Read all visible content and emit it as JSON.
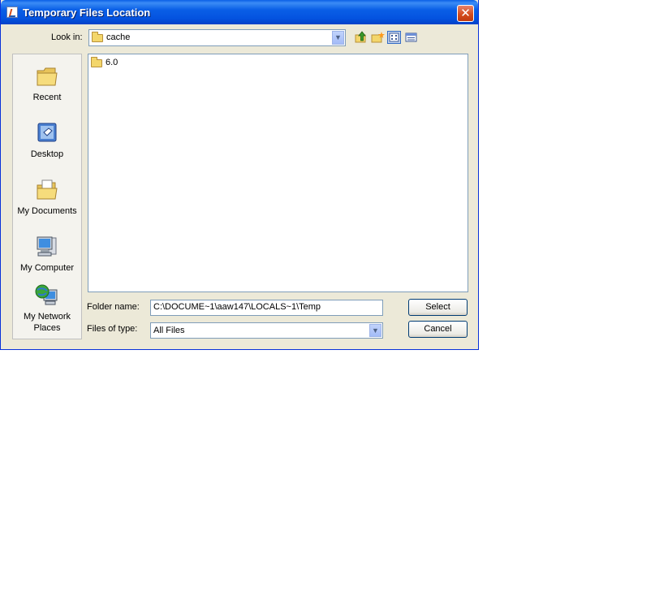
{
  "window": {
    "title": "Temporary Files Location",
    "close_label": "✕"
  },
  "lookin": {
    "label": "Look in:",
    "value": "cache"
  },
  "toolbar": {
    "icons": [
      "up-one-level-icon",
      "create-new-folder-icon",
      "list-view-icon",
      "details-view-icon"
    ]
  },
  "places": [
    {
      "label": "Recent",
      "icon": "recent-folder-icon"
    },
    {
      "label": "Desktop",
      "icon": "desktop-icon"
    },
    {
      "label": "My Documents",
      "icon": "my-documents-icon"
    },
    {
      "label": "My Computer",
      "icon": "my-computer-icon"
    },
    {
      "label": "My Network Places",
      "icon": "network-places-icon"
    }
  ],
  "files": [
    {
      "name": "6.0",
      "icon": "folder-icon"
    }
  ],
  "folder_name": {
    "label": "Folder name:",
    "value": "C:\\DOCUME~1\\aaw147\\LOCALS~1\\Temp"
  },
  "files_of_type": {
    "label": "Files of type:",
    "value": "All Files"
  },
  "buttons": {
    "select": "Select",
    "cancel": "Cancel"
  }
}
